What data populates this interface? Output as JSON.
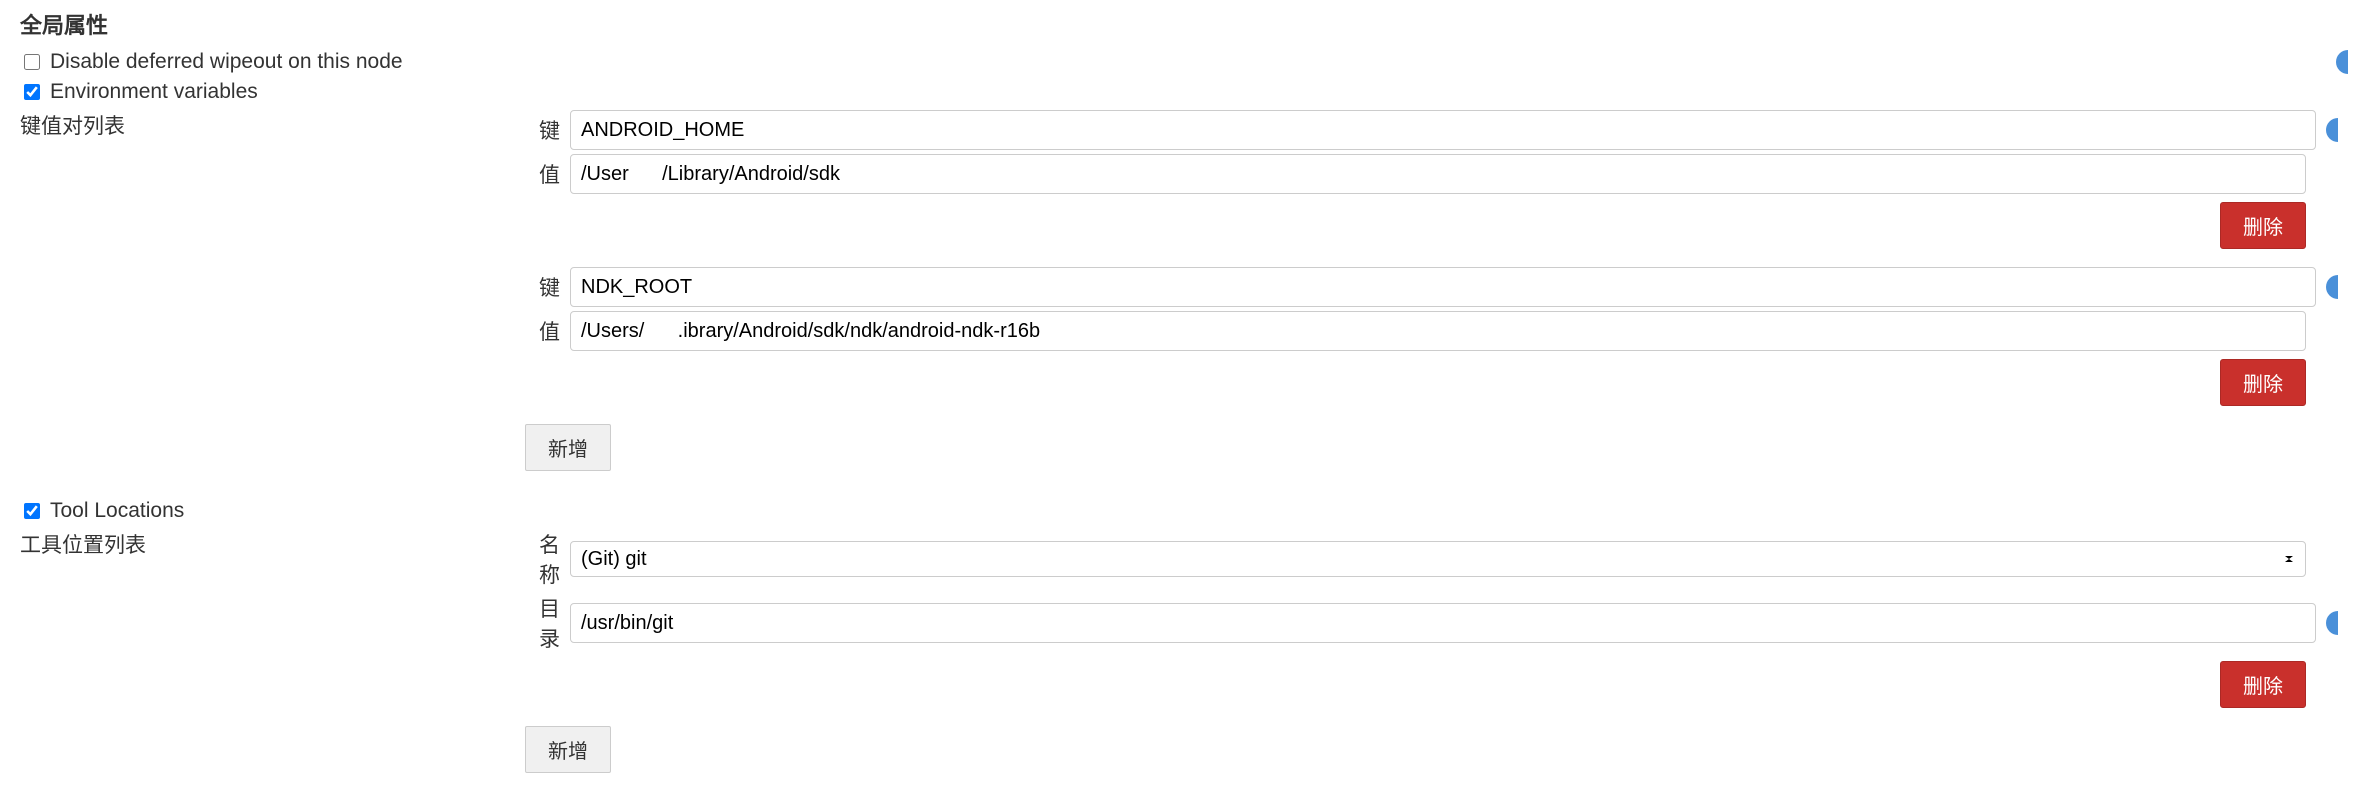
{
  "section": {
    "title": "全局属性"
  },
  "options": {
    "disable_wipeout_label": "Disable deferred wipeout on this node",
    "disable_wipeout_checked": false,
    "env_vars_label": "Environment variables",
    "env_vars_checked": true,
    "tool_locations_label": "Tool Locations",
    "tool_locations_checked": true
  },
  "env": {
    "list_label": "键值对列表",
    "key_label": "键",
    "value_label": "值",
    "items": [
      {
        "key": "ANDROID_HOME",
        "value": "/User      /Library/Android/sdk"
      },
      {
        "key": "NDK_ROOT",
        "value": "/Users/      .ibrary/Android/sdk/ndk/android-ndk-r16b"
      }
    ]
  },
  "tools": {
    "list_label": "工具位置列表",
    "name_label": "名称",
    "dir_label": "目录",
    "name_value": "(Git) git",
    "dir_value": "/usr/bin/git"
  },
  "buttons": {
    "delete": "删除",
    "add": "新增"
  }
}
